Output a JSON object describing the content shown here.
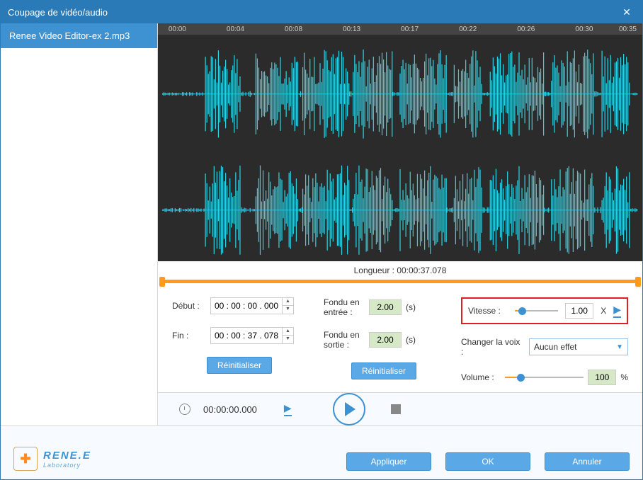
{
  "titlebar": {
    "title": "Coupage de vidéo/audio"
  },
  "sidebar": {
    "items": [
      {
        "label": "Renee Video Editor-ex 2.mp3"
      }
    ]
  },
  "timeline": {
    "ticks": [
      "00:00",
      "00:04",
      "00:08",
      "00:13",
      "00:17",
      "00:22",
      "00:26",
      "00:30",
      "00:35"
    ]
  },
  "length": {
    "label": "Longueur : 00:00:37.078"
  },
  "controls": {
    "debut_label": "Début :",
    "debut_value": "00 : 00 : 00 . 000",
    "fin_label": "Fin :",
    "fin_value": "00 : 00 : 37 . 078",
    "reset1": "Réinitialiser",
    "fondu_in_label": "Fondu en entrée :",
    "fondu_in_value": "2.00",
    "fondu_out_label": "Fondu en sortie :",
    "fondu_out_value": "2.00",
    "sec_unit": "(s)",
    "reset2": "Réinitialiser",
    "vitesse_label": "Vitesse :",
    "vitesse_value": "1.00",
    "vitesse_unit": "X",
    "voice_label": "Changer la voix :",
    "voice_value": "Aucun effet",
    "volume_label": "Volume :",
    "volume_value": "100",
    "volume_unit": "%"
  },
  "playbar": {
    "time": "00:00:00.000"
  },
  "footer": {
    "logo_main": "RENE.E",
    "logo_sub": "Laboratory",
    "apply": "Appliquer",
    "ok": "OK",
    "cancel": "Annuler"
  }
}
